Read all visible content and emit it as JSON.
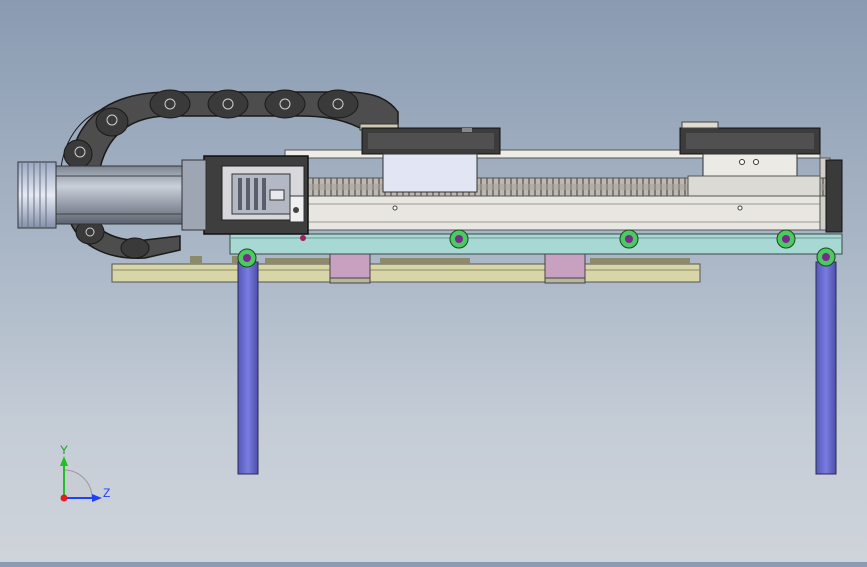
{
  "viewport": {
    "triad": {
      "y_label": "Y",
      "z_label": "Z"
    }
  },
  "colors": {
    "background_top": "#8a9bb1",
    "background_bottom": "#cfd4da",
    "frame_plate": "#a8d8d4",
    "base_plate": "#d8d6a6",
    "legs": "#6a6cc8",
    "clamps": "#c8a0c0",
    "dark_parts": "#3a3a3a",
    "cable_chain": "#555555",
    "motor": "#9fa7b3",
    "rail": "#e8e6e0",
    "bolts": "#4cc864",
    "axis_y": "#20c020",
    "axis_z": "#2040ff",
    "axis_origin": "#e02020"
  }
}
